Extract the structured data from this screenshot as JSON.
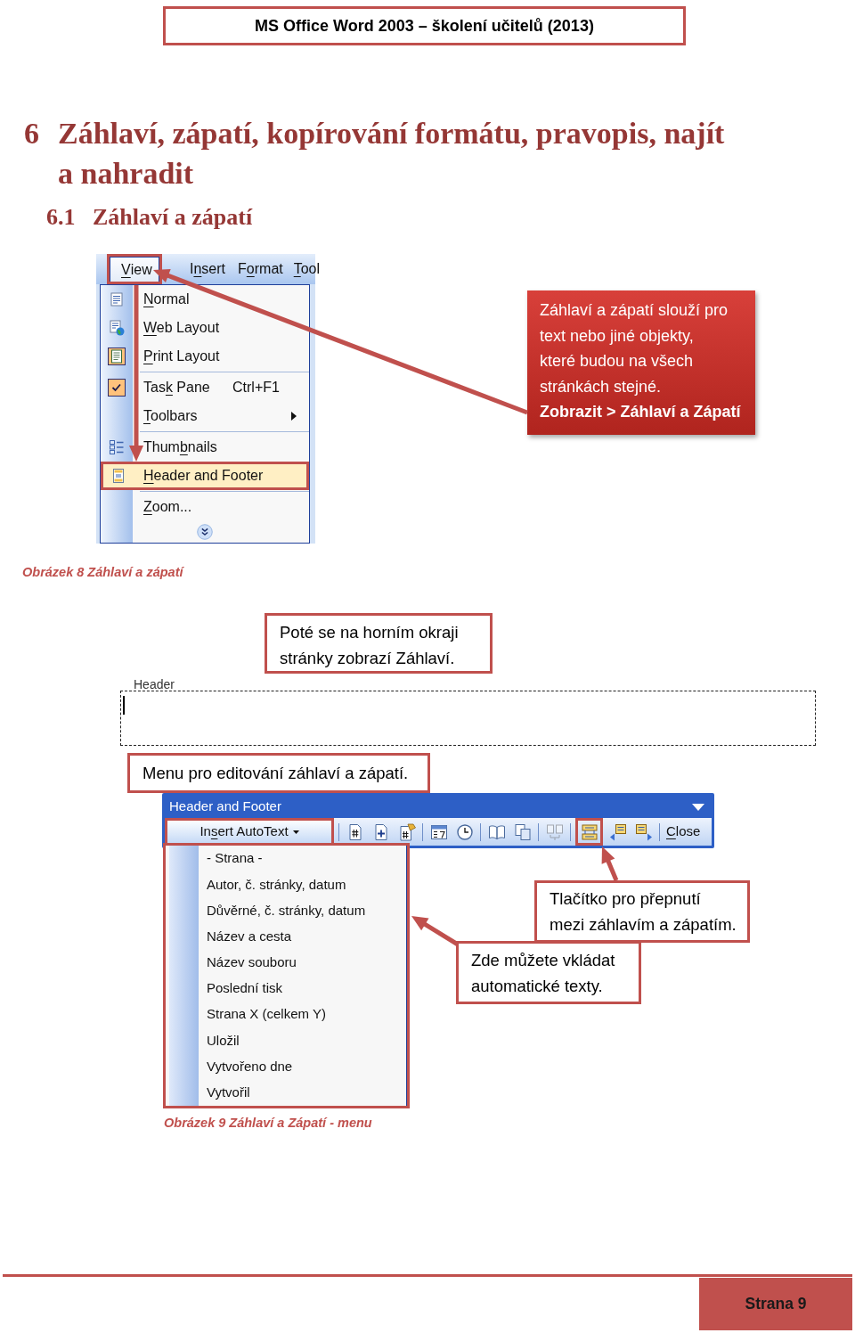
{
  "running_header": "MS Office Word 2003 – školení učitelů (2013)",
  "heading": {
    "number": "6",
    "title": "Záhlaví, zápatí, kopírování formátu, pravopis, najít a nahradit"
  },
  "subheading": {
    "number": "6.1",
    "title": "Záhlaví a zápatí"
  },
  "figure_1": {
    "menu_bar": [
      {
        "label": {
          "key": "V",
          "post": "iew"
        },
        "selected": true,
        "framed": true
      },
      {
        "label": {
          "pre": "I",
          "key": "n",
          "post": "sert"
        },
        "selected": false,
        "framed": false
      },
      {
        "label": {
          "pre": "F",
          "key": "o",
          "post": "rmat"
        },
        "selected": false,
        "framed": false
      },
      {
        "label": {
          "key": "T",
          "post": "ool"
        },
        "selected": false,
        "framed": false
      }
    ],
    "menu_groups": [
      [
        {
          "kind": "command",
          "label": {
            "key": "N",
            "post": "ormal"
          },
          "checked": false,
          "highlighted": false,
          "framed": false
        },
        {
          "kind": "command",
          "label": {
            "key": "W",
            "post": "eb Layout"
          },
          "checked": false,
          "highlighted": false,
          "framed": false
        },
        {
          "kind": "command",
          "label": {
            "key": "P",
            "post": "rint Layout"
          },
          "checked": true,
          "highlighted": false,
          "framed": false
        }
      ],
      [
        {
          "kind": "command",
          "label": {
            "pre": "Tas",
            "key": "k",
            "post": " Pane"
          },
          "shortcut": "Ctrl+F1",
          "checked": true,
          "highlighted": false,
          "framed": false
        },
        {
          "kind": "submenu",
          "label": {
            "key": "T",
            "post": "oolbars"
          },
          "checked": false,
          "highlighted": false,
          "framed": false
        }
      ],
      [
        {
          "kind": "command",
          "label": {
            "pre": "Thum",
            "key": "b",
            "post": "nails"
          },
          "checked": false,
          "highlighted": false,
          "framed": false
        },
        {
          "kind": "command",
          "label": {
            "key": "H",
            "post": "eader and Footer"
          },
          "checked": false,
          "highlighted": true,
          "framed": true
        }
      ],
      [
        {
          "kind": "command",
          "label": {
            "key": "Z",
            "post": "oom..."
          },
          "checked": false,
          "highlighted": false,
          "framed": false
        }
      ]
    ],
    "callout": {
      "text": "Záhlaví a zápatí slouží pro text nebo jiné objekty, které budou na všech stránkách stejné.",
      "command_path": "Zobrazit > Záhlaví a Zápatí"
    },
    "caption": "Obrázek 8 Záhlaví a zápatí"
  },
  "figure_2": {
    "header_callout": "Poté se na horním okraji stránky zobrazí Záhlaví.",
    "header_area": {
      "label": "Header"
    },
    "toolbar_callout": "Menu pro editování záhlaví a zápatí.",
    "toolbar": {
      "title": "Header and Footer",
      "groups": [
        [
          {
            "kind": "dropdown",
            "label": {
              "pre": "In",
              "key": "s",
              "post": "ert AutoText"
            },
            "disabled": false,
            "framed": true
          }
        ],
        [
          {
            "kind": "icon",
            "disabled": false,
            "framed": false
          },
          {
            "kind": "icon",
            "disabled": false,
            "framed": false
          },
          {
            "kind": "icon",
            "disabled": false,
            "framed": false
          }
        ],
        [
          {
            "kind": "icon",
            "disabled": false,
            "framed": false
          },
          {
            "kind": "icon",
            "disabled": false,
            "framed": false
          }
        ],
        [
          {
            "kind": "icon",
            "disabled": false,
            "framed": false
          },
          {
            "kind": "icon",
            "disabled": false,
            "framed": false
          }
        ],
        [
          {
            "kind": "icon",
            "disabled": true,
            "framed": false
          }
        ],
        [
          {
            "kind": "icon",
            "disabled": false,
            "framed": true
          },
          {
            "kind": "icon",
            "disabled": false,
            "framed": false
          },
          {
            "kind": "icon",
            "disabled": false,
            "framed": false
          }
        ],
        [
          {
            "kind": "text",
            "label": {
              "key": "C",
              "post": "lose"
            },
            "disabled": false,
            "framed": false
          }
        ]
      ]
    },
    "autotext_menu": {
      "framed": true,
      "items": [
        "- Strana -",
        "Autor, č. stránky, datum",
        "Důvěrné, č. stránky, datum",
        "Název a cesta",
        "Název souboru",
        "Poslední tisk",
        "Strana X (celkem Y)",
        "Uložil",
        "Vytvořeno dne",
        "Vytvořil"
      ]
    },
    "switch_callout": "Tlačítko pro přepnutí mezi záhlavím a zápatím.",
    "autotext_callout": "Zde můžete vkládat automatické texty.",
    "caption": "Obrázek 9 Záhlaví a Zápatí - menu"
  },
  "footer": {
    "page": "Strana 9"
  }
}
